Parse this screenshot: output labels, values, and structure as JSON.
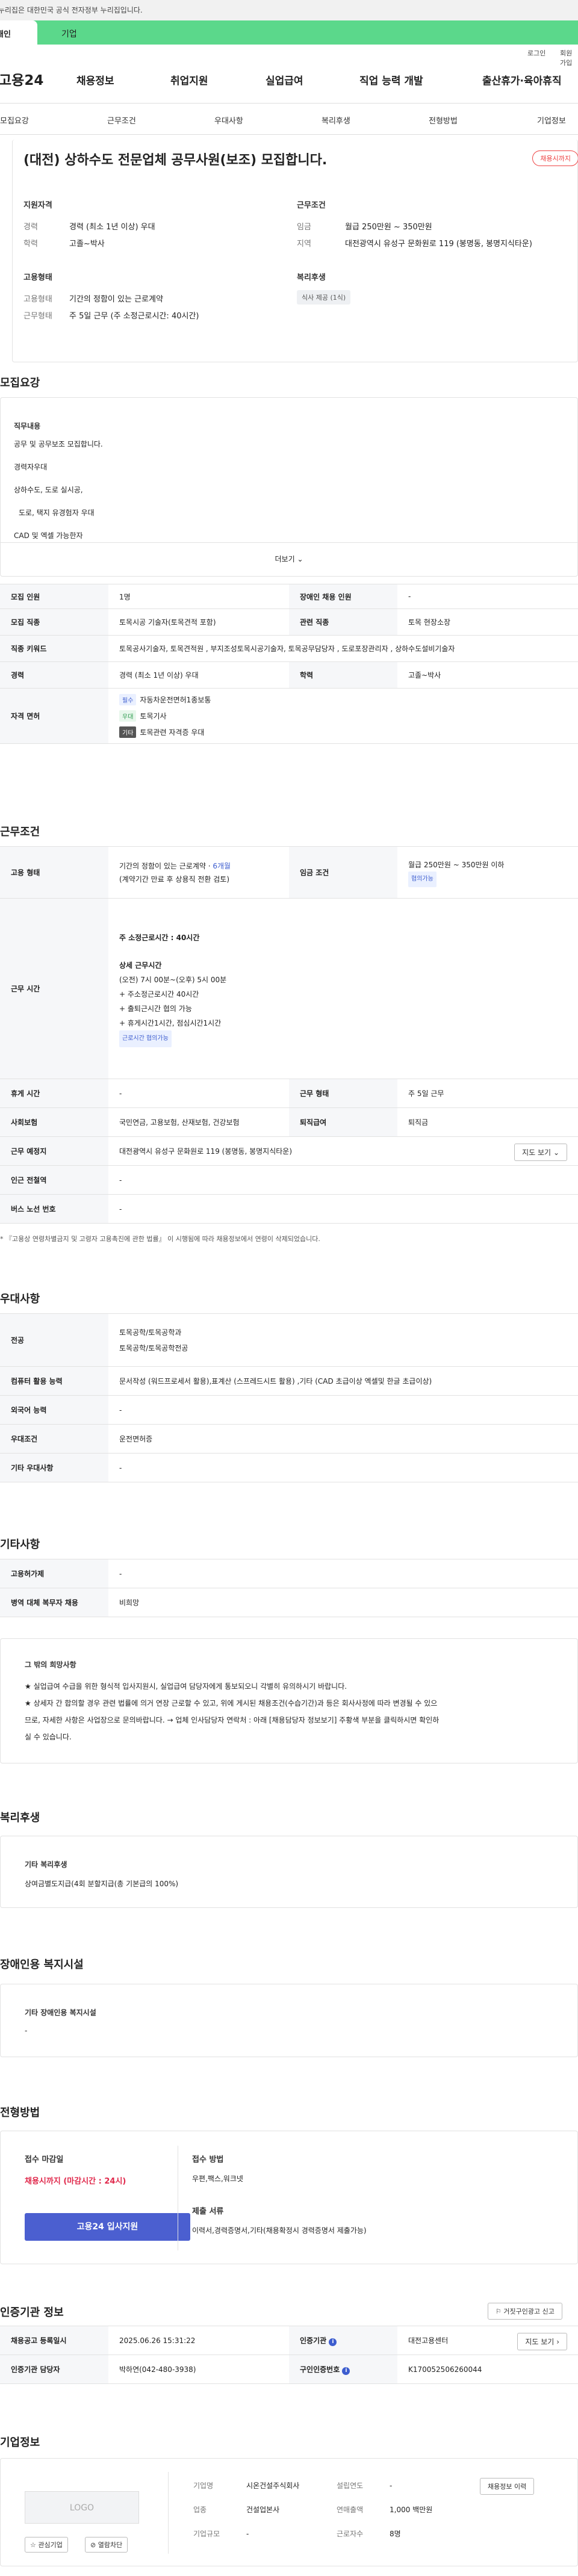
{
  "gov_bar": {
    "text": "이 누리집은 대한민국 공식 전자정부 누리집입니다."
  },
  "band": {
    "tab_first": "개인",
    "tab_second": "기업"
  },
  "top_links": {
    "login": "로그인",
    "signup": "회원가입"
  },
  "nav": {
    "logo": "고용24",
    "items": [
      "채용정보",
      "취업지원",
      "실업급여",
      "직업 능력 개발",
      "출산휴가·육아휴직"
    ]
  },
  "subnav": {
    "items": [
      "모집요강",
      "근무조건",
      "우대사항",
      "복리후생",
      "전형방법",
      "기업정보"
    ]
  },
  "summary": {
    "title": "(대전) 상하수도 전문업체 공무사원(보조) 모집합니다.",
    "badge": "채용시까지",
    "qual_label": "지원자격",
    "qual_rows": [
      {
        "k": "경력",
        "v": "경력 (최소 1년 이상) 우대"
      },
      {
        "k": "학력",
        "v": "고졸~박사"
      }
    ],
    "work_label": "근무조건",
    "work_rows": [
      {
        "k": "임금",
        "v": "월급 250만원 ~ 350만원"
      },
      {
        "k": "지역",
        "v": "대전광역시 유성구 문화원로 119 (봉명동, 봉명지식타운)"
      }
    ],
    "emp_label": "고용형태",
    "emp_rows": [
      {
        "k": "고용형태",
        "v": "기간의 정함이 있는 근로계약"
      },
      {
        "k": "근무형태",
        "v": "주 5일 근무 (주 소정근로시간: 40시간)"
      }
    ],
    "welfare_label": "복리후생",
    "welfare_pill": "식사 제공 (1식)"
  },
  "recruit": {
    "title": "모집요강",
    "duty_label": "직무내용",
    "duty_lines": [
      "공무 및 공무보조 모집합니다.",
      "경력자우대",
      "상하수도, 도로 실시공,",
      "도로, 택지 유경험자 우대",
      "CAD 및 엑셀 가능한자"
    ],
    "more": "더보기",
    "rows": {
      "headcount_k": "모집 인원",
      "headcount_v": "1명",
      "disabled_k": "장애인 채용 인원",
      "disabled_v": "-",
      "job_k": "모집 직종",
      "job_v": "토목시공 기술자(토목견적 포함)",
      "rel_k": "관련 직종",
      "rel_v": "토목 현장소장",
      "kw_k": "직종 키워드",
      "kw_v": "토목공사기술자, 토목견적원 , 부지조성토목시공기술자, 토목공무담당자 , 도로포장관리자 , 상하수도설비기술자",
      "career_k": "경력",
      "career_v": "경력 (최소 1년 이상) 우대",
      "edu_k": "학력",
      "edu_v": "고졸~박사",
      "lic_k": "자격 면허",
      "licenses": [
        {
          "badge": "필수",
          "name": "자동차운전면허1종보통"
        },
        {
          "badge": "우대",
          "name": "토목기사"
        },
        {
          "badge": "기타",
          "name": "토목관련 자격증 우대"
        }
      ]
    }
  },
  "condition": {
    "title": "근무조건",
    "emp_k": "고용 형태",
    "emp_v1": "기간의 정함이 있는 근로계약 · ",
    "emp_months": "6개월",
    "emp_v2": "(계약기간 만료 후 상용직 전환 검토)",
    "wage_k": "임금 조건",
    "wage_v": "월급 250만원 ~ 350만원 이하",
    "wage_badge": "협의가능",
    "time_k": "근무 시간",
    "time_lines": [
      "주 소정근로시간 : 40시간",
      "상세 근무시간",
      "(오전) 7시 00분~(오후) 5시 00분",
      "+ 주소정근로시간 40시간",
      "+ 출퇴근시간 협의 가능",
      "+ 휴게시간1시간, 점심시간1시간"
    ],
    "time_badge": "근로시간 협의가능",
    "rest_k": "휴게 시간",
    "rest_v": "-",
    "type_k": "근무 형태",
    "type_v": "주 5일 근무",
    "ins_k": "사회보험",
    "ins_v": "국민연금, 고용보험, 산재보험, 건강보험",
    "retire_k": "퇴직급여",
    "retire_v": "퇴직금",
    "place_k": "근무 예정지",
    "place_v": "대전광역시 유성구 문화원로 119 (봉명동, 봉명지식타운)",
    "map_btn": "지도 보기",
    "subway_k": "인근 전철역",
    "subway_v": "-",
    "bus_k": "버스 노선 번호",
    "bus_v": "-",
    "footnote": "* 『고용상 연령차별금지 및 고령자 고용촉진에 관한 법률』 이 시행됨에 따라 채용정보에서 연령이 삭제되었습니다."
  },
  "prefer": {
    "title": "우대사항",
    "major_k": "전공",
    "major_v1": "토목공학/토목공학과",
    "major_v2": "토목공학/토목공학전공",
    "pc_k": "컴퓨터 활용 능력",
    "pc_v": "문서작성 (워드프로세서 활용),표계산 (스프레드시트 활용) ,기타 (CAD 초급이상  엑셀및 한글 초급이상)",
    "lang_k": "외국어 능력",
    "lang_v": "-",
    "cond_k": "우대조건",
    "cond_v": "운전면허증",
    "etc_k": "기타 우대사항",
    "etc_v": "-"
  },
  "other": {
    "title": "기타사항",
    "hire_k": "고용허가제",
    "hire_v": "-",
    "mil_k": "병역 대체 복무자 채용",
    "mil_v": "비희망",
    "other_label": "그 밖의 희망사항",
    "other_lines": [
      "★ 실업급여 수급을 위한 형식적 입사지원시, 실업급여 담당자에게 통보되오니 각별히 유의하시기 바랍니다.",
      "★ 상세자 간 합의할 경우 관련 법률에 의거 연장 근로할 수 있고, 위에 게시된 채용조건(수습기간)과 등은 회사사정에 따라 변경될 수 있으",
      "므로, 자세한 사항은 사업장으로 문의바랍니다. → 업체 인사담당자 연락처 : 아래 [채용담당자 정보보기] 주황색 부분을 클릭하시면 확인하",
      "실 수 있습니다."
    ]
  },
  "welfare": {
    "title": "복리후생",
    "label": "기타 복리후생",
    "text": "상여금별도지급(4회 분할지급(총 기본급의 100%)"
  },
  "disabled": {
    "title": "장애인용 복지시설",
    "label": "기타 장애인용 복지시설",
    "text": "-"
  },
  "process": {
    "title": "전형방법",
    "deadline_label": "접수 마감일",
    "deadline_value": "채용시까지 (마감시간 : 24시)",
    "apply_btn": "고용24 입사지원",
    "method_label": "접수 방법",
    "method_value": "우편,팩스,워크넷",
    "docs_label": "제출 서류",
    "docs_value": "이력서,경력증명서,기타(채용확정시 경력증명서 제출가능)"
  },
  "agency": {
    "title": "인증기관 정보",
    "report_btn": "거짓구인광고 신고",
    "reg_k": "채용공고 등록일시",
    "reg_v": "2025.06.26 15:31:22",
    "org_k": "인증기관",
    "org_v": "대전고용센터",
    "map_btn": "지도 보기",
    "staff_k": "인증기관 담당자",
    "staff_v": "박하연(042-480-3938)",
    "num_k": "구인인증번호",
    "num_v": "K170052506260044"
  },
  "company": {
    "title": "기업정보",
    "logo": "LOGO",
    "fav_btn": "관심기업",
    "share_btn": "열람차단",
    "rows": [
      {
        "k": "기업명",
        "v": "시온건설주식회사"
      },
      {
        "k": "설립연도",
        "v": "-"
      },
      {
        "k": "업종",
        "v": "건설업본사"
      },
      {
        "k": "연매출액",
        "v": "1,000 백만원"
      },
      {
        "k": "기업규모",
        "v": "-"
      },
      {
        "k": "근로자수",
        "v": "8명"
      }
    ],
    "history_btn": "채용정보 이력"
  }
}
